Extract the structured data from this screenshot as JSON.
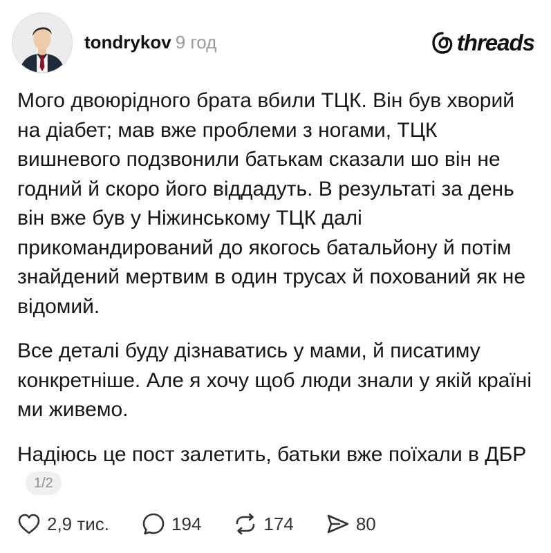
{
  "post": {
    "username": "tondrykov",
    "time_ago": "9 год",
    "brand": "threads",
    "paragraphs": [
      "Мого двоюрідного брата вбили ТЦК. Він був хворий на діабет; мав вже проблеми з ногами, ТЦК вишневого подзвонили батькам сказали шо він не годний й скоро його віддадуть. В результаті за день він вже був у Ніжинському ТЦК далі прикомандирований до якогось батальйону й потім знайдений мертвим в один трусах й похований як не відомий.",
      "Все деталі буду дізнаватись у мами, й писатиму конкретніше. Але я хочу щоб люди знали у якій країні ми живемо.",
      "Надіюсь це пост залетить, батьки вже поїхали в ДБР"
    ],
    "page_indicator": "1/2"
  },
  "actions": {
    "likes": "2,9 тис.",
    "replies": "194",
    "reposts": "174",
    "shares": "80"
  },
  "icons": {
    "like": "heart-icon",
    "reply": "comment-bubble-icon",
    "repost": "repost-arrows-icon",
    "share": "send-icon",
    "brand": "threads-logo-icon"
  }
}
